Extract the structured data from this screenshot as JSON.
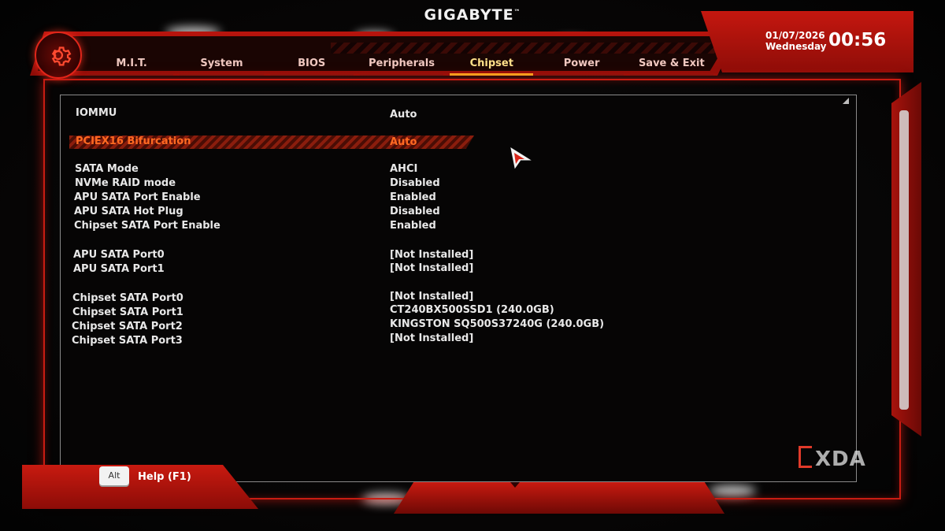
{
  "brand": {
    "name": "GIGABYTE",
    "mark": "™"
  },
  "clock": {
    "date": "01/07/2026",
    "day": "Wednesday",
    "time": "00:56"
  },
  "tabs": [
    {
      "label": "M.I.T.",
      "active": false
    },
    {
      "label": "System",
      "active": false
    },
    {
      "label": "BIOS",
      "active": false
    },
    {
      "label": "Peripherals",
      "active": false
    },
    {
      "label": "Chipset",
      "active": true
    },
    {
      "label": "Power",
      "active": false
    },
    {
      "label": "Save & Exit",
      "active": false
    }
  ],
  "settings": [
    {
      "label": "IOMMU",
      "value": "Auto"
    },
    {
      "label": "PCIEX16 Bifurcation",
      "value": "Auto",
      "selected": true
    },
    {
      "label": "SATA Mode",
      "value": "AHCI"
    },
    {
      "label": "NVMe RAID mode",
      "value": "Disabled"
    },
    {
      "label": "APU SATA Port Enable",
      "value": "Enabled"
    },
    {
      "label": "APU SATA Hot Plug",
      "value": "Disabled"
    },
    {
      "label": "Chipset SATA Port Enable",
      "value": "Enabled"
    },
    {
      "label": "APU SATA Port0",
      "value": "[Not Installed]"
    },
    {
      "label": "APU SATA Port1",
      "value": "[Not Installed]"
    },
    {
      "label": "Chipset SATA Port0",
      "value": "[Not Installed]"
    },
    {
      "label": "Chipset SATA Port1",
      "value": "CT240BX500SSD1 (240.0GB)"
    },
    {
      "label": "Chipset SATA Port2",
      "value": "KINGSTON SQ500S37240G (240.0GB)"
    },
    {
      "label": "Chipset SATA Port3",
      "value": "[Not Installed]"
    }
  ],
  "footer": {
    "alt_key": "Alt",
    "help": "Help (F1)"
  },
  "watermark": "XDA",
  "colors": {
    "accent_red": "#c81c12",
    "selected_text": "#ff6a22",
    "active_tab": "#ffe08a"
  }
}
